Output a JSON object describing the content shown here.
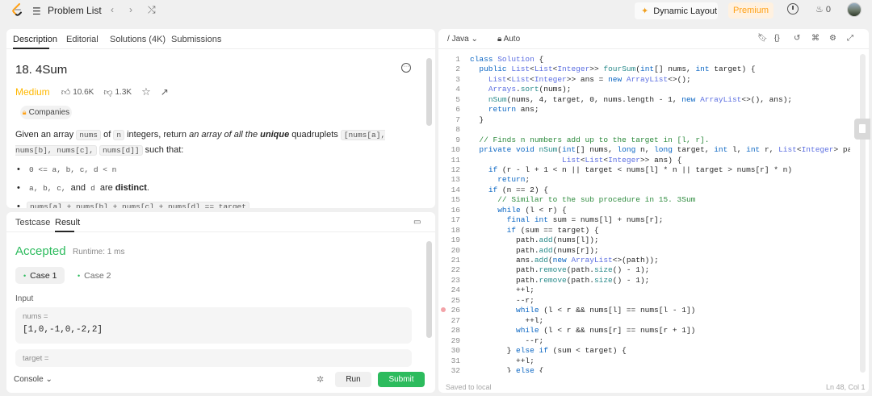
{
  "topbar": {
    "title": "Problem List",
    "prev_icon": "chevron-left-icon",
    "next_icon": "chevron-right-icon",
    "shuffle_icon": "shuffle-icon",
    "dynamic_layout": "Dynamic Layout",
    "premium": "Premium",
    "streak_count": "0"
  },
  "description_tabs": [
    "Description",
    "Editorial",
    "Solutions (4K)",
    "Submissions"
  ],
  "problem": {
    "title": "18. 4Sum",
    "difficulty": "Medium",
    "likes": "10.6K",
    "dislikes": "1.3K",
    "companies": "Companies",
    "desc_prefix": "Given an array ",
    "desc_nums": "nums",
    "desc_of": " of ",
    "desc_n": "n",
    "desc_integers": " integers, return ",
    "desc_italic": "an array of all the ",
    "desc_unique": "unique",
    "desc_quad": " quadruplets ",
    "desc_code_quad": "[nums[a], nums[b], nums[c],",
    "desc_code_quad2": "nums[d]]",
    "desc_such": " such that:",
    "bullet1": "0 <= a, b, c, d < n",
    "bullet2_code": "a, b, c,",
    "bullet2_and": " and ",
    "bullet2_d": "d",
    "bullet2_are": " are ",
    "bullet2_distinct": "distinct",
    "bullet2_dot": ".",
    "bullet3": "nums[a] + nums[b] + nums[c] + nums[d] == target"
  },
  "test_tabs": [
    "Testcase",
    "Result"
  ],
  "result": {
    "status": "Accepted",
    "runtime": "Runtime: 1 ms",
    "cases": [
      "Case 1",
      "Case 2"
    ],
    "input_label": "Input",
    "nums_label": "nums =",
    "nums_value": "[1,0,-1,0,-2,2]",
    "target_label": "target ="
  },
  "console": {
    "console_label": "Console",
    "run": "Run",
    "submit": "Submit"
  },
  "editor": {
    "language": "Java",
    "mode": "Auto",
    "saved": "Saved to local",
    "position": "Ln 48, Col 1",
    "lines": [
      "class Solution {",
      "  public List<List<Integer>> fourSum(int[] nums, int target) {",
      "    List<List<Integer>> ans = new ArrayList<>();",
      "    Arrays.sort(nums);",
      "    nSum(nums, 4, target, 0, nums.length - 1, new ArrayList<>(), ans);",
      "    return ans;",
      "  }",
      "",
      "  // Finds n numbers add up to the target in [l, r].",
      "  private void nSum(int[] nums, long n, long target, int l, int r, List<Integer> path,",
      "                    List<List<Integer>> ans) {",
      "    if (r - l + 1 < n || target < nums[l] * n || target > nums[r] * n)",
      "      return;",
      "    if (n == 2) {",
      "      // Similar to the sub procedure in 15. 3Sum",
      "      while (l < r) {",
      "        final int sum = nums[l] + nums[r];",
      "        if (sum == target) {",
      "          path.add(nums[l]);",
      "          path.add(nums[r]);",
      "          ans.add(new ArrayList<>(path));",
      "          path.remove(path.size() - 1);",
      "          path.remove(path.size() - 1);",
      "          ++l;",
      "          --r;",
      "          while (l < r && nums[l] == nums[l - 1])",
      "            ++l;",
      "          while (l < r && nums[r] == nums[r + 1])",
      "            --r;",
      "        } else if (sum < target) {",
      "          ++l;",
      "        } else {"
    ],
    "breakpoint_line": 26
  },
  "colors": {
    "accent_green": "#2cbb5d",
    "medium": "#ffb800",
    "premium": "#ffa116"
  }
}
